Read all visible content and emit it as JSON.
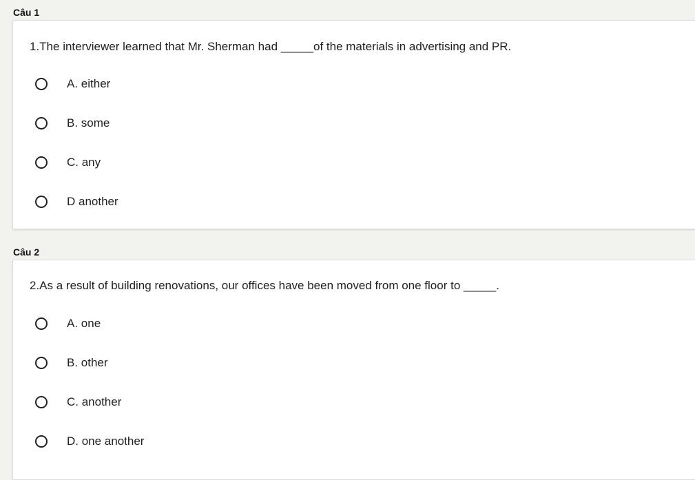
{
  "questions": [
    {
      "label": "Câu 1",
      "text": "1.The interviewer learned that Mr. Sherman had _____of the materials in advertising and PR.",
      "options": [
        "A. either",
        "B. some",
        "C. any",
        "D another"
      ]
    },
    {
      "label": "Câu 2",
      "text": "2.As a result of building renovations, our offices have been moved from one floor to _____.",
      "options": [
        "A. one",
        "B. other",
        "C. another",
        "D. one another"
      ]
    }
  ],
  "colors": {
    "page_background": "#f2f2ef",
    "card_background": "#ffffff",
    "text": "#202124"
  },
  "icons": {
    "option_marker": "radio-unchecked-icon"
  }
}
